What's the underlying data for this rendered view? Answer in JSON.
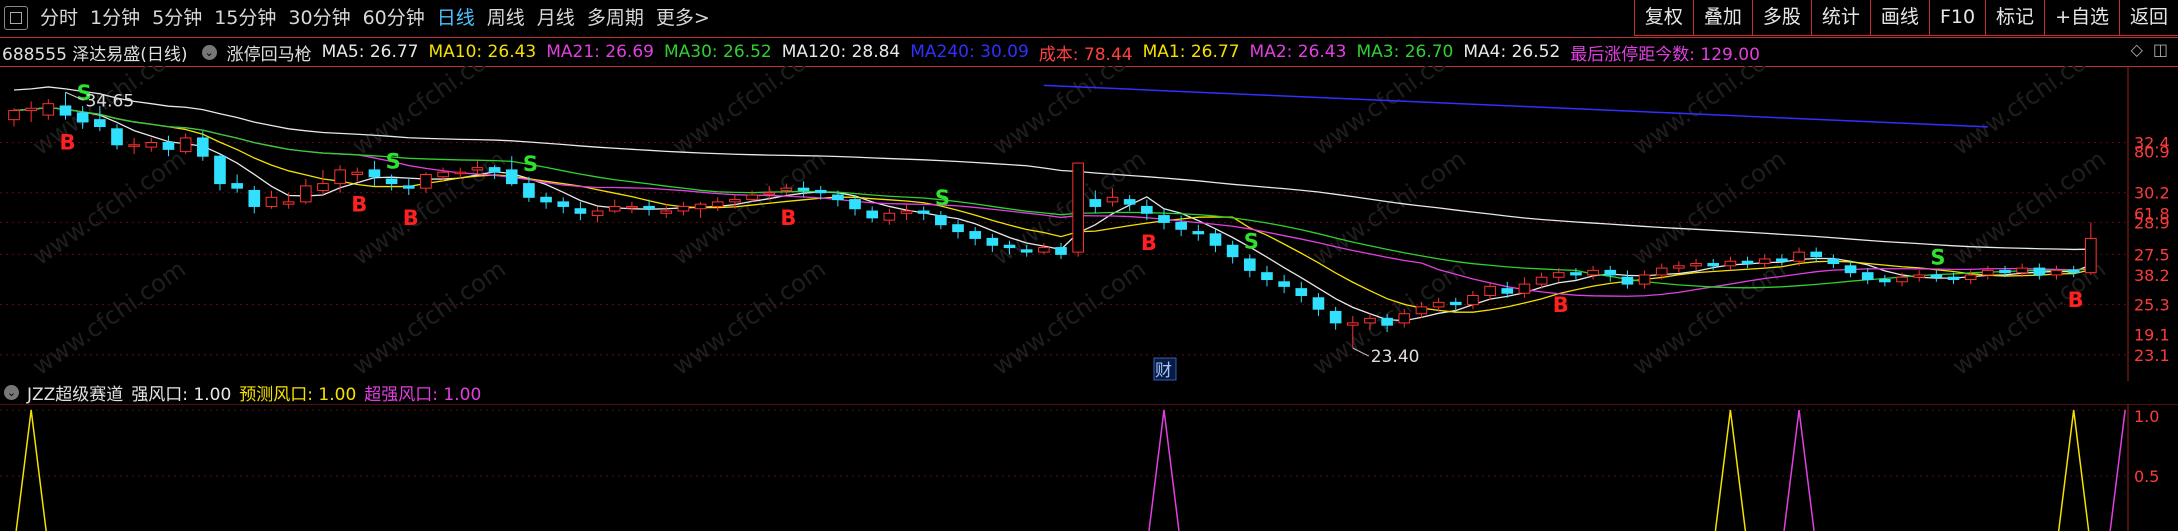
{
  "toolbar": {
    "periods": [
      "分时",
      "1分钟",
      "5分钟",
      "15分钟",
      "30分钟",
      "60分钟",
      "日线",
      "周线",
      "月线",
      "多周期",
      "更多>"
    ],
    "active": "日线",
    "right": [
      "复权",
      "叠加",
      "多股",
      "统计",
      "画线",
      "F10",
      "标记",
      "+自选",
      "返回"
    ]
  },
  "info": {
    "stock": "688555 泽达易盛(日线)",
    "indicator": "涨停回马枪",
    "items": [
      {
        "label": "MA5: 26.77",
        "color": "#e8e8e8"
      },
      {
        "label": "MA10: 26.43",
        "color": "#f5e000"
      },
      {
        "label": "MA21: 26.69",
        "color": "#e040e0"
      },
      {
        "label": "MA30: 26.52",
        "color": "#30d030"
      },
      {
        "label": "MA120: 28.84",
        "color": "#e8e8e8"
      },
      {
        "label": "MA240: 30.09",
        "color": "#3030ff"
      },
      {
        "label": "成本: 78.44",
        "color": "#ff4040"
      },
      {
        "label": "MA1: 26.77",
        "color": "#f5e000"
      },
      {
        "label": "MA2: 26.43",
        "color": "#e040e0"
      },
      {
        "label": "MA3: 26.70",
        "color": "#30d030"
      },
      {
        "label": "MA4: 26.52",
        "color": "#e8e8e8"
      },
      {
        "label": "最后涨停距今数: 129.00",
        "color": "#e040e0"
      }
    ]
  },
  "indicator": {
    "name": "JZZ超级赛道",
    "items": [
      {
        "label": "强风口: 1.00",
        "color": "#e8e8e8"
      },
      {
        "label": "预测风口: 1.00",
        "color": "#f5e000"
      },
      {
        "label": "超强风口: 1.00",
        "color": "#e040e0"
      }
    ]
  },
  "chart_data": {
    "type": "candlestick",
    "price_axis_labels": [
      "32.4",
      "30.2",
      "28.9",
      "27.5",
      "25.3",
      "23.1"
    ],
    "pct_axis_labels": [
      "80.9",
      "61.8",
      "38.2",
      "19.1"
    ],
    "high_label": "34.65",
    "low_label": "23.40",
    "finance_marker": "财",
    "ylim": [
      22.7,
      35.4
    ],
    "candles": [
      [
        33.4,
        33.8,
        33.9,
        33.1
      ],
      [
        33.8,
        33.9,
        34.2,
        33.3
      ],
      [
        33.6,
        34.1,
        34.3,
        33.4
      ],
      [
        34.0,
        33.6,
        34.6,
        33.4
      ],
      [
        33.7,
        33.3,
        34.0,
        33.0
      ],
      [
        33.4,
        33.1,
        34.0,
        32.9
      ],
      [
        33.0,
        32.3,
        33.2,
        32.1
      ],
      [
        32.3,
        32.3,
        32.6,
        31.9
      ],
      [
        32.2,
        32.4,
        32.6,
        32.0
      ],
      [
        32.4,
        32.1,
        32.7,
        31.8
      ],
      [
        32.0,
        32.6,
        32.8,
        31.9
      ],
      [
        32.6,
        31.8,
        32.9,
        31.6
      ],
      [
        31.8,
        30.6,
        31.9,
        30.3
      ],
      [
        30.6,
        30.4,
        31.0,
        30.2
      ],
      [
        30.3,
        29.6,
        30.5,
        29.3
      ],
      [
        29.6,
        30.0,
        30.3,
        29.5
      ],
      [
        29.7,
        29.8,
        30.2,
        29.5
      ],
      [
        29.8,
        30.5,
        30.8,
        29.7
      ],
      [
        30.3,
        30.6,
        31.2,
        30.1
      ],
      [
        30.6,
        31.2,
        31.4,
        30.2
      ],
      [
        31.0,
        31.1,
        31.3,
        30.7
      ],
      [
        31.2,
        30.9,
        31.6,
        30.5
      ],
      [
        30.8,
        30.6,
        31.0,
        30.3
      ],
      [
        30.5,
        30.4,
        30.8,
        30.1
      ],
      [
        30.4,
        31.0,
        31.1,
        30.2
      ],
      [
        30.9,
        31.1,
        31.3,
        30.7
      ],
      [
        31.1,
        31.1,
        31.3,
        30.8
      ],
      [
        31.2,
        31.3,
        31.6,
        31.0
      ],
      [
        31.3,
        31.1,
        31.4,
        30.8
      ],
      [
        31.2,
        30.6,
        31.8,
        30.5
      ],
      [
        30.6,
        30.0,
        30.9,
        29.8
      ],
      [
        30.0,
        29.8,
        30.2,
        29.5
      ],
      [
        29.8,
        29.6,
        30.0,
        29.3
      ],
      [
        29.5,
        29.3,
        29.8,
        29.0
      ],
      [
        29.2,
        29.4,
        29.6,
        28.9
      ],
      [
        29.4,
        29.6,
        29.9,
        29.3
      ],
      [
        29.6,
        29.6,
        29.8,
        29.3
      ],
      [
        29.6,
        29.5,
        29.9,
        29.2
      ],
      [
        29.3,
        29.4,
        29.7,
        29.1
      ],
      [
        29.4,
        29.6,
        29.8,
        29.2
      ],
      [
        29.5,
        29.7,
        29.8,
        29.1
      ],
      [
        29.6,
        29.8,
        30.0,
        29.4
      ],
      [
        29.8,
        29.9,
        30.1,
        29.5
      ],
      [
        29.9,
        30.1,
        30.3,
        29.8
      ],
      [
        30.2,
        30.2,
        30.5,
        29.9
      ],
      [
        30.3,
        30.4,
        30.6,
        30.1
      ],
      [
        30.4,
        30.3,
        30.7,
        30.0
      ],
      [
        30.3,
        30.2,
        30.5,
        29.9
      ],
      [
        30.1,
        29.9,
        30.3,
        29.6
      ],
      [
        29.9,
        29.5,
        30.1,
        29.2
      ],
      [
        29.4,
        29.1,
        29.6,
        28.9
      ],
      [
        29.0,
        29.3,
        29.5,
        28.8
      ],
      [
        29.3,
        29.4,
        29.7,
        29.0
      ],
      [
        29.4,
        29.3,
        29.6,
        29.0
      ],
      [
        29.2,
        28.8,
        29.4,
        28.6
      ],
      [
        28.8,
        28.5,
        29.0,
        28.2
      ],
      [
        28.5,
        28.2,
        28.7,
        27.9
      ],
      [
        28.2,
        27.9,
        28.4,
        27.6
      ],
      [
        27.9,
        27.8,
        28.1,
        27.5
      ],
      [
        27.7,
        27.6,
        27.9,
        27.4
      ],
      [
        27.6,
        27.8,
        28.0,
        27.5
      ],
      [
        27.8,
        27.5,
        28.0,
        27.3
      ],
      [
        27.6,
        31.5,
        31.5,
        27.4
      ],
      [
        29.9,
        29.6,
        30.3,
        29.3
      ],
      [
        29.8,
        30.0,
        30.4,
        29.6
      ],
      [
        29.9,
        29.7,
        30.1,
        29.4
      ],
      [
        29.6,
        29.3,
        29.9,
        29.0
      ],
      [
        29.2,
        28.9,
        29.5,
        28.6
      ],
      [
        28.9,
        28.6,
        29.2,
        28.3
      ],
      [
        28.5,
        28.4,
        28.8,
        28.1
      ],
      [
        28.4,
        27.9,
        28.6,
        27.6
      ],
      [
        27.9,
        27.4,
        28.1,
        27.1
      ],
      [
        27.3,
        26.8,
        27.5,
        26.5
      ],
      [
        26.7,
        26.4,
        27.0,
        26.1
      ],
      [
        26.3,
        26.1,
        26.6,
        25.8
      ],
      [
        26.0,
        25.7,
        26.3,
        25.4
      ],
      [
        25.6,
        25.1,
        25.8,
        24.8
      ],
      [
        25.0,
        24.5,
        25.2,
        24.2
      ],
      [
        24.4,
        24.5,
        24.8,
        23.4
      ],
      [
        24.5,
        24.7,
        24.9,
        24.2
      ],
      [
        24.7,
        24.4,
        24.9,
        24.1
      ],
      [
        24.5,
        24.9,
        25.1,
        24.3
      ],
      [
        24.9,
        25.2,
        25.4,
        24.7
      ],
      [
        25.2,
        25.4,
        25.6,
        25.0
      ],
      [
        25.4,
        25.3,
        25.6,
        25.0
      ],
      [
        25.3,
        25.7,
        25.9,
        25.1
      ],
      [
        25.7,
        26.1,
        26.3,
        25.5
      ],
      [
        26.0,
        25.8,
        26.3,
        25.6
      ],
      [
        25.8,
        26.2,
        26.5,
        25.6
      ],
      [
        26.2,
        26.5,
        26.7,
        26.0
      ],
      [
        26.5,
        26.7,
        26.9,
        26.3
      ],
      [
        26.7,
        26.6,
        26.9,
        26.4
      ],
      [
        26.6,
        26.8,
        27.0,
        26.4
      ],
      [
        26.8,
        26.6,
        27.0,
        26.3
      ],
      [
        26.5,
        26.2,
        26.8,
        26.0
      ],
      [
        26.2,
        26.6,
        26.8,
        26.0
      ],
      [
        26.6,
        26.9,
        27.1,
        26.4
      ],
      [
        26.9,
        27.0,
        27.2,
        26.7
      ],
      [
        27.0,
        27.1,
        27.3,
        26.8
      ],
      [
        27.1,
        27.0,
        27.3,
        26.8
      ],
      [
        27.0,
        27.2,
        27.4,
        26.8
      ],
      [
        27.2,
        27.1,
        27.4,
        26.9
      ],
      [
        27.1,
        27.3,
        27.5,
        26.9
      ],
      [
        27.3,
        27.2,
        27.5,
        27.0
      ],
      [
        27.2,
        27.6,
        27.8,
        27.0
      ],
      [
        27.6,
        27.4,
        27.8,
        27.2
      ],
      [
        27.3,
        27.1,
        27.5,
        26.9
      ],
      [
        27.0,
        26.7,
        27.2,
        26.5
      ],
      [
        26.7,
        26.4,
        26.9,
        26.2
      ],
      [
        26.4,
        26.3,
        26.6,
        26.1
      ],
      [
        26.3,
        26.5,
        26.7,
        26.1
      ],
      [
        26.5,
        26.6,
        26.8,
        26.3
      ],
      [
        26.6,
        26.5,
        26.8,
        26.3
      ],
      [
        26.5,
        26.4,
        26.7,
        26.2
      ],
      [
        26.4,
        26.6,
        26.8,
        26.2
      ],
      [
        26.6,
        26.8,
        27.0,
        26.4
      ],
      [
        26.8,
        26.7,
        27.0,
        26.5
      ],
      [
        26.7,
        26.9,
        27.1,
        26.5
      ],
      [
        26.9,
        26.6,
        27.1,
        26.4
      ],
      [
        26.6,
        26.8,
        27.0,
        26.4
      ],
      [
        26.8,
        26.7,
        27.0,
        26.5
      ],
      [
        26.7,
        28.2,
        28.9,
        26.6
      ]
    ],
    "ma_series": [
      {
        "name": "MA5",
        "color": "#e8e8e8"
      },
      {
        "name": "MA10",
        "color": "#f5e000"
      },
      {
        "name": "MA21",
        "color": "#e040e0"
      },
      {
        "name": "MA30",
        "color": "#30d030"
      },
      {
        "name": "MA120",
        "color": "#e8e8e8"
      },
      {
        "name": "MA240",
        "color": "#3030ff"
      }
    ],
    "signals": [
      {
        "type": "S",
        "index": 4
      },
      {
        "type": "B",
        "index": 3
      },
      {
        "type": "B",
        "index": 20
      },
      {
        "type": "S",
        "index": 22
      },
      {
        "type": "B",
        "index": 23
      },
      {
        "type": "S",
        "index": 30
      },
      {
        "type": "B",
        "index": 45
      },
      {
        "type": "S",
        "index": 54
      },
      {
        "type": "B",
        "index": 66
      },
      {
        "type": "S",
        "index": 72
      },
      {
        "type": "B",
        "index": 90
      },
      {
        "type": "S",
        "index": 112
      },
      {
        "type": "B",
        "index": 120
      }
    ],
    "indicator_levels": [
      "1.0",
      "0.5"
    ],
    "indicator_spikes": [
      {
        "index": 1,
        "color": "#f5e000"
      },
      {
        "index": 67,
        "color": "#e040e0"
      },
      {
        "index": 100,
        "color": "#f5e000"
      },
      {
        "index": 104,
        "color": "#e040e0"
      },
      {
        "index": 120,
        "color": "#f5e000"
      },
      {
        "index": 123,
        "color": "#e040e0"
      }
    ],
    "watermark": "www.cfchi.com"
  }
}
